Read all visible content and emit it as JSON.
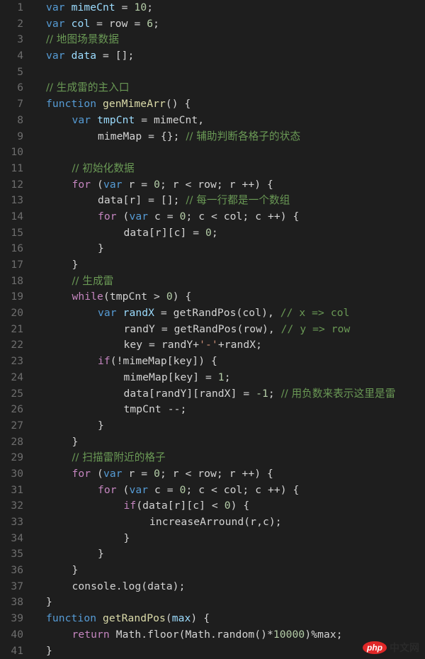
{
  "editor": {
    "theme": {
      "background": "#1e1e1e",
      "line_number": "#6e6e6e",
      "keyword_decl": "#569cd6",
      "keyword_ctrl": "#c586c0",
      "variable": "#9cdcfe",
      "function": "#dcdcaa",
      "number": "#b5cea8",
      "string": "#ce9178",
      "comment": "#6a9955",
      "text": "#d4d4d4"
    },
    "lines": [
      {
        "n": "1",
        "indent": 0,
        "tokens": [
          [
            "kw-decl",
            "var"
          ],
          [
            "plain",
            " "
          ],
          [
            "var",
            "mimeCnt"
          ],
          [
            "plain",
            " = "
          ],
          [
            "num",
            "10"
          ],
          [
            "plain",
            ";"
          ]
        ]
      },
      {
        "n": "2",
        "indent": 0,
        "tokens": [
          [
            "kw-decl",
            "var"
          ],
          [
            "plain",
            " "
          ],
          [
            "var",
            "col"
          ],
          [
            "plain",
            " = row = "
          ],
          [
            "num",
            "6"
          ],
          [
            "plain",
            ";"
          ]
        ]
      },
      {
        "n": "3",
        "indent": 0,
        "tokens": [
          [
            "cmt",
            "// 地图场景数据"
          ]
        ]
      },
      {
        "n": "4",
        "indent": 0,
        "tokens": [
          [
            "kw-decl",
            "var"
          ],
          [
            "plain",
            " "
          ],
          [
            "var",
            "data"
          ],
          [
            "plain",
            " = [];"
          ]
        ]
      },
      {
        "n": "5",
        "indent": 0,
        "tokens": []
      },
      {
        "n": "6",
        "indent": 0,
        "tokens": [
          [
            "cmt",
            "// 生成雷的主入口"
          ]
        ]
      },
      {
        "n": "7",
        "indent": 0,
        "tokens": [
          [
            "kw-decl",
            "function"
          ],
          [
            "plain",
            " "
          ],
          [
            "fn",
            "genMimeArr"
          ],
          [
            "plain",
            "() {"
          ]
        ]
      },
      {
        "n": "8",
        "indent": 1,
        "tokens": [
          [
            "kw-decl",
            "var"
          ],
          [
            "plain",
            " "
          ],
          [
            "var",
            "tmpCnt"
          ],
          [
            "plain",
            " = mimeCnt,"
          ]
        ]
      },
      {
        "n": "9",
        "indent": 2,
        "tokens": [
          [
            "plain",
            "mimeMap = {}; "
          ],
          [
            "cmt",
            "// 辅助判断各格子的状态"
          ]
        ]
      },
      {
        "n": "10",
        "indent": 0,
        "tokens": []
      },
      {
        "n": "11",
        "indent": 1,
        "tokens": [
          [
            "cmt",
            "// 初始化数据"
          ]
        ]
      },
      {
        "n": "12",
        "indent": 1,
        "tokens": [
          [
            "kw-ctrl",
            "for"
          ],
          [
            "plain",
            " ("
          ],
          [
            "kw-decl",
            "var"
          ],
          [
            "plain",
            " r = "
          ],
          [
            "num",
            "0"
          ],
          [
            "plain",
            "; r < row; r ++) {"
          ]
        ]
      },
      {
        "n": "13",
        "indent": 2,
        "tokens": [
          [
            "plain",
            "data[r] = []; "
          ],
          [
            "cmt",
            "// 每一行都是一个数组"
          ]
        ]
      },
      {
        "n": "14",
        "indent": 2,
        "tokens": [
          [
            "kw-ctrl",
            "for"
          ],
          [
            "plain",
            " ("
          ],
          [
            "kw-decl",
            "var"
          ],
          [
            "plain",
            " c = "
          ],
          [
            "num",
            "0"
          ],
          [
            "plain",
            "; c < col; c ++) {"
          ]
        ]
      },
      {
        "n": "15",
        "indent": 3,
        "tokens": [
          [
            "plain",
            "data[r][c] = "
          ],
          [
            "num",
            "0"
          ],
          [
            "plain",
            ";"
          ]
        ]
      },
      {
        "n": "16",
        "indent": 2,
        "tokens": [
          [
            "plain",
            "}"
          ]
        ]
      },
      {
        "n": "17",
        "indent": 1,
        "tokens": [
          [
            "plain",
            "}"
          ]
        ]
      },
      {
        "n": "18",
        "indent": 1,
        "tokens": [
          [
            "cmt",
            "// 生成雷"
          ]
        ]
      },
      {
        "n": "19",
        "indent": 1,
        "tokens": [
          [
            "kw-ctrl",
            "while"
          ],
          [
            "plain",
            "(tmpCnt > "
          ],
          [
            "num",
            "0"
          ],
          [
            "plain",
            ") {"
          ]
        ]
      },
      {
        "n": "20",
        "indent": 2,
        "tokens": [
          [
            "kw-decl",
            "var"
          ],
          [
            "plain",
            " "
          ],
          [
            "var",
            "randX"
          ],
          [
            "plain",
            " = getRandPos(col), "
          ],
          [
            "cmt",
            "// x => col"
          ]
        ]
      },
      {
        "n": "21",
        "indent": 3,
        "tokens": [
          [
            "plain",
            "randY = getRandPos(row), "
          ],
          [
            "cmt",
            "// y => row"
          ]
        ]
      },
      {
        "n": "22",
        "indent": 3,
        "tokens": [
          [
            "plain",
            "key = randY+"
          ],
          [
            "str",
            "'-'"
          ],
          [
            "plain",
            "+randX;"
          ]
        ]
      },
      {
        "n": "23",
        "indent": 2,
        "tokens": [
          [
            "kw-ctrl",
            "if"
          ],
          [
            "plain",
            "(!mimeMap[key]) {"
          ]
        ]
      },
      {
        "n": "24",
        "indent": 3,
        "tokens": [
          [
            "plain",
            "mimeMap[key] = "
          ],
          [
            "num",
            "1"
          ],
          [
            "plain",
            ";"
          ]
        ]
      },
      {
        "n": "25",
        "indent": 3,
        "tokens": [
          [
            "plain",
            "data[randY][randX] = "
          ],
          [
            "num",
            "-1"
          ],
          [
            "plain",
            "; "
          ],
          [
            "cmt",
            "// 用负数来表示这里是雷"
          ]
        ]
      },
      {
        "n": "26",
        "indent": 3,
        "tokens": [
          [
            "plain",
            "tmpCnt --;"
          ]
        ]
      },
      {
        "n": "27",
        "indent": 2,
        "tokens": [
          [
            "plain",
            "}"
          ]
        ]
      },
      {
        "n": "28",
        "indent": 1,
        "tokens": [
          [
            "plain",
            "}"
          ]
        ]
      },
      {
        "n": "29",
        "indent": 1,
        "tokens": [
          [
            "cmt",
            "// 扫描雷附近的格子"
          ]
        ]
      },
      {
        "n": "30",
        "indent": 1,
        "tokens": [
          [
            "kw-ctrl",
            "for"
          ],
          [
            "plain",
            " ("
          ],
          [
            "kw-decl",
            "var"
          ],
          [
            "plain",
            " r = "
          ],
          [
            "num",
            "0"
          ],
          [
            "plain",
            "; r < row; r ++) {"
          ]
        ]
      },
      {
        "n": "31",
        "indent": 2,
        "tokens": [
          [
            "kw-ctrl",
            "for"
          ],
          [
            "plain",
            " ("
          ],
          [
            "kw-decl",
            "var"
          ],
          [
            "plain",
            " c = "
          ],
          [
            "num",
            "0"
          ],
          [
            "plain",
            "; c < col; c ++) {"
          ]
        ]
      },
      {
        "n": "32",
        "indent": 3,
        "tokens": [
          [
            "kw-ctrl",
            "if"
          ],
          [
            "plain",
            "(data[r][c] < "
          ],
          [
            "num",
            "0"
          ],
          [
            "plain",
            ") {"
          ]
        ]
      },
      {
        "n": "33",
        "indent": 4,
        "tokens": [
          [
            "plain",
            "increaseArround(r,c);"
          ]
        ]
      },
      {
        "n": "34",
        "indent": 3,
        "tokens": [
          [
            "plain",
            "}"
          ]
        ]
      },
      {
        "n": "35",
        "indent": 2,
        "tokens": [
          [
            "plain",
            "}"
          ]
        ]
      },
      {
        "n": "36",
        "indent": 1,
        "tokens": [
          [
            "plain",
            "}"
          ]
        ]
      },
      {
        "n": "37",
        "indent": 1,
        "tokens": [
          [
            "plain",
            "console.log(data);"
          ]
        ]
      },
      {
        "n": "38",
        "indent": 0,
        "tokens": [
          [
            "plain",
            "}"
          ]
        ]
      },
      {
        "n": "39",
        "indent": 0,
        "tokens": [
          [
            "kw-decl",
            "function"
          ],
          [
            "plain",
            " "
          ],
          [
            "fn",
            "getRandPos"
          ],
          [
            "plain",
            "("
          ],
          [
            "param",
            "max"
          ],
          [
            "plain",
            ") {"
          ]
        ]
      },
      {
        "n": "40",
        "indent": 1,
        "tokens": [
          [
            "kw-ctrl",
            "return"
          ],
          [
            "plain",
            " Math.floor(Math.random()*"
          ],
          [
            "num",
            "10000"
          ],
          [
            "plain",
            ")%max;"
          ]
        ]
      },
      {
        "n": "41",
        "indent": 0,
        "tokens": [
          [
            "plain",
            "}"
          ]
        ]
      }
    ]
  },
  "watermark": {
    "badge": "php",
    "text": "中文网"
  }
}
